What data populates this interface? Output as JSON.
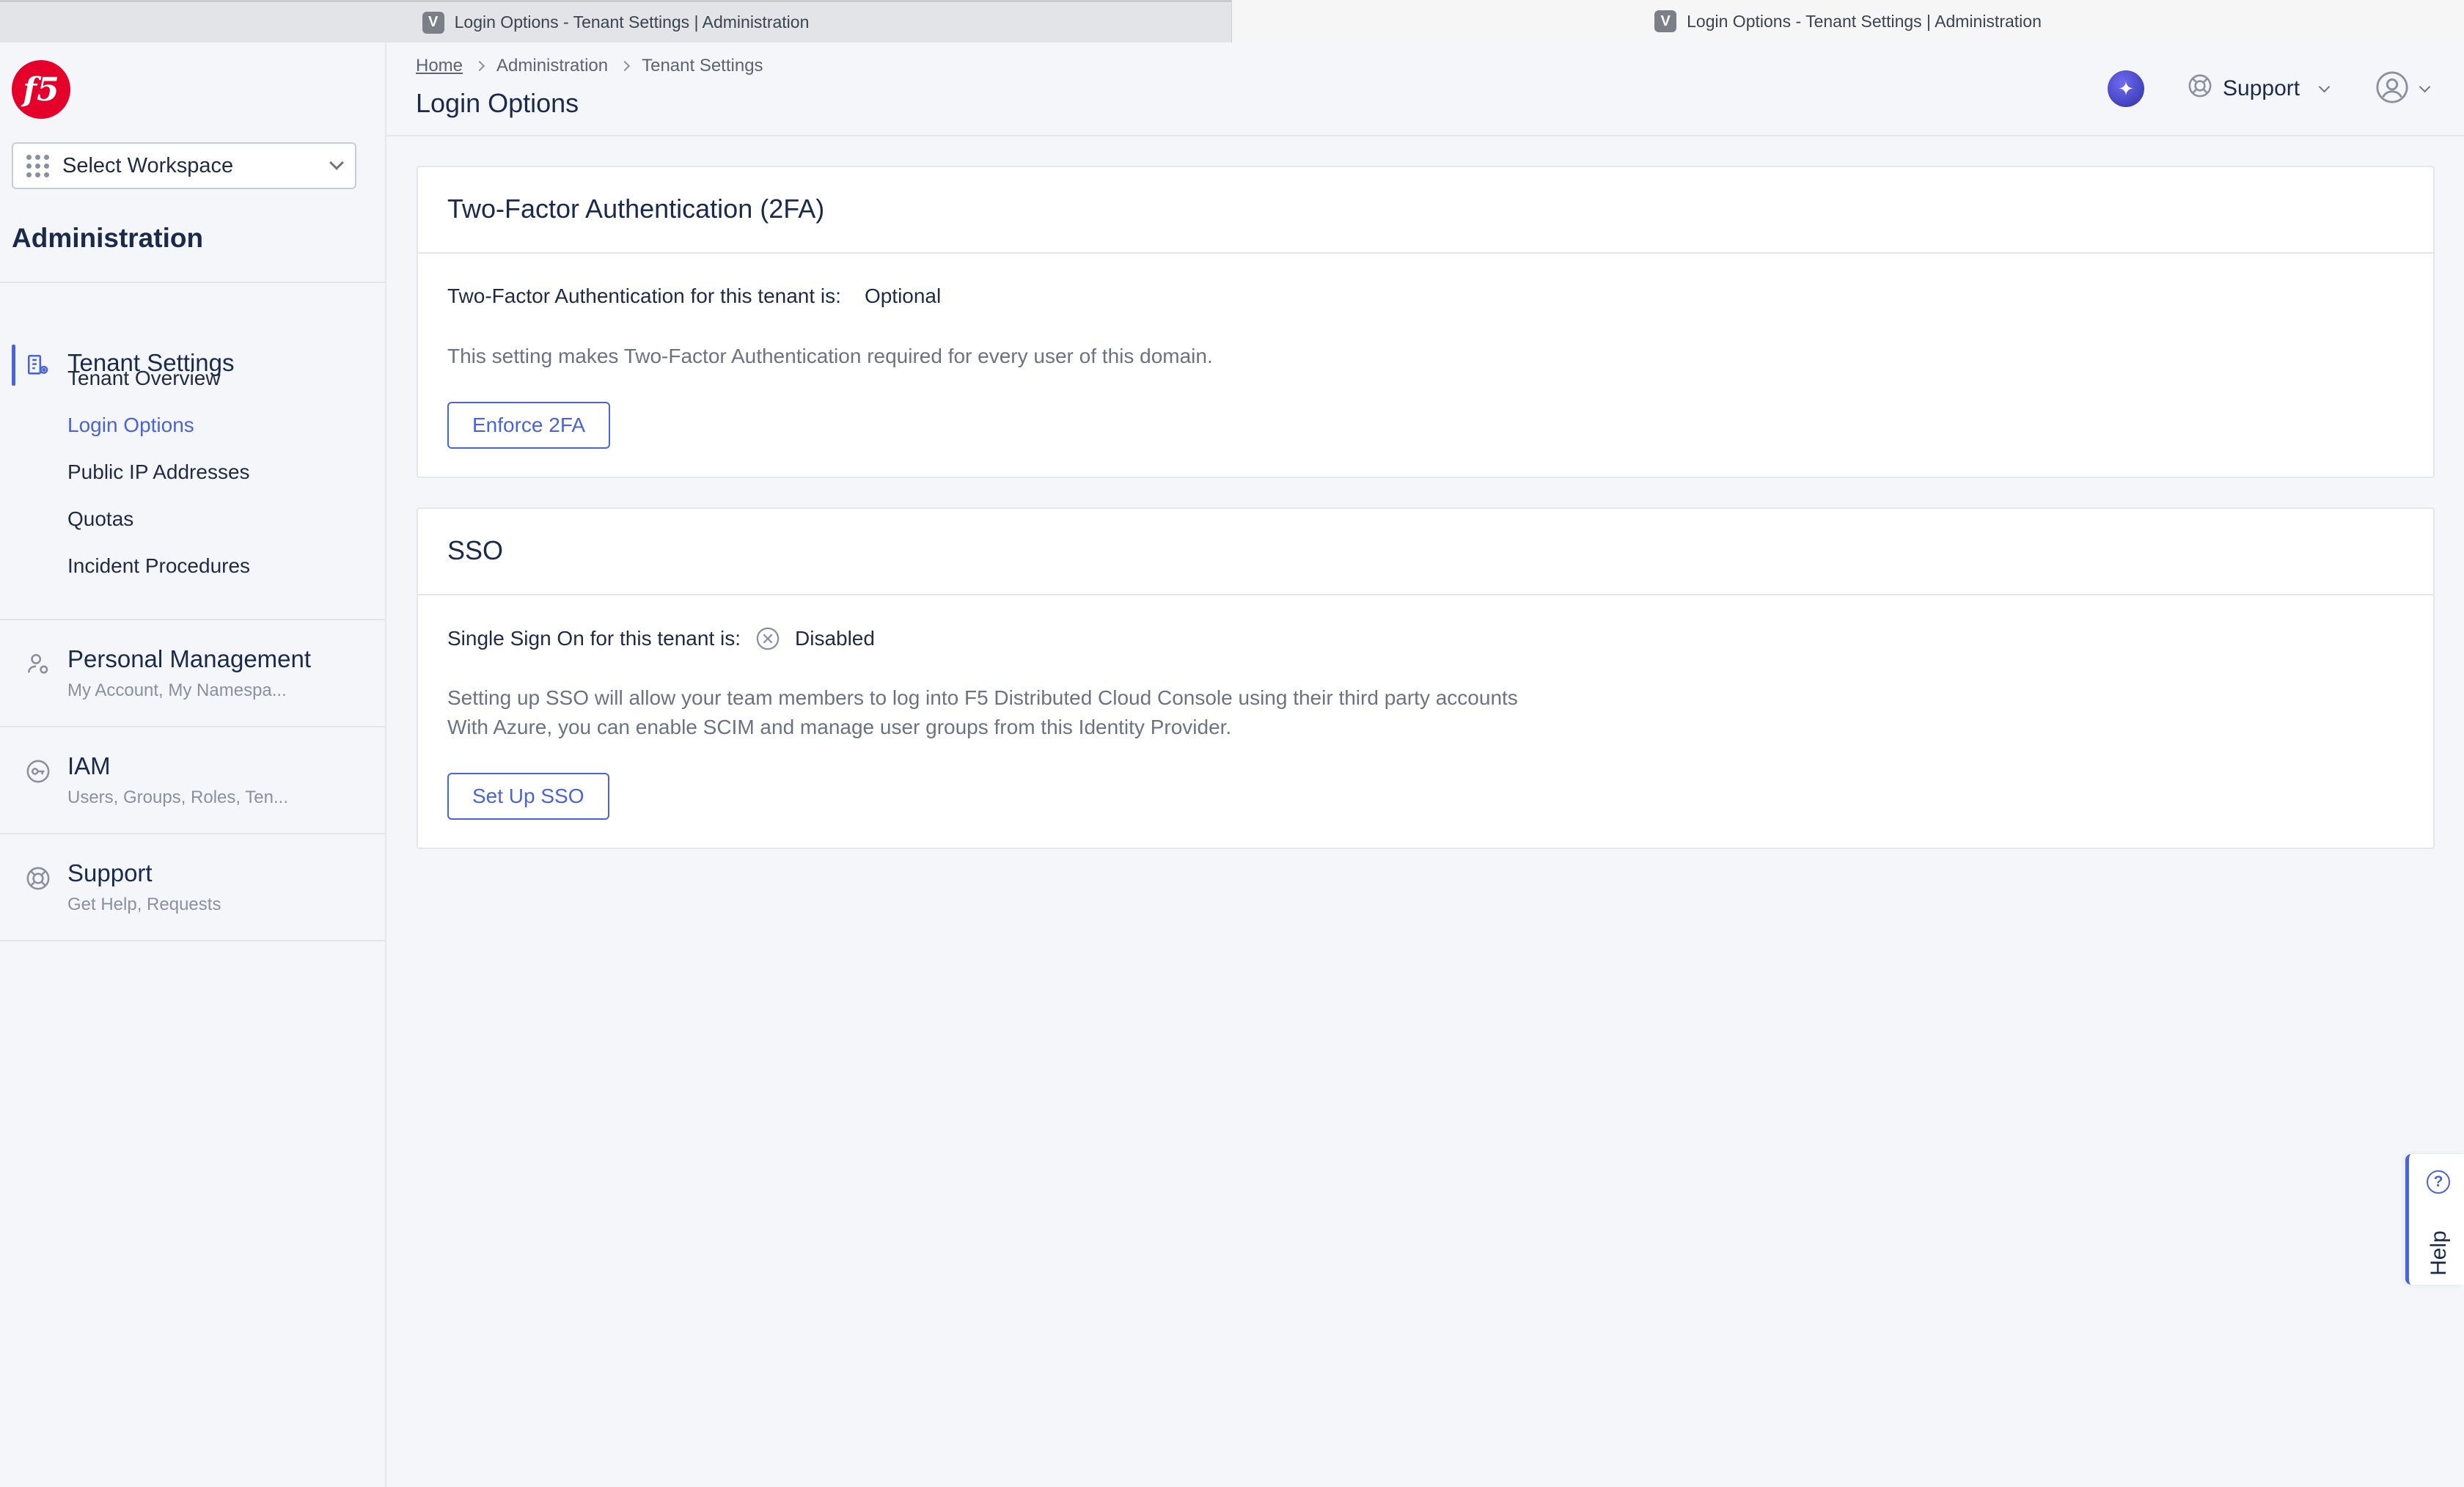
{
  "browser": {
    "tabs": [
      {
        "favicon": "V",
        "title": "Login Options - Tenant Settings | Administration"
      },
      {
        "favicon": "V",
        "title": "Login Options - Tenant Settings | Administration"
      }
    ]
  },
  "sidebar": {
    "logo_text": "f5",
    "workspace_label": "Select Workspace",
    "title": "Administration",
    "tenant_settings": {
      "label": "Tenant Settings",
      "icon": "building-gear-icon",
      "items": [
        "Tenant Overview",
        "Login Options",
        "Public IP Addresses",
        "Quotas",
        "Incident Procedures"
      ],
      "active_item": "Login Options"
    },
    "sections": [
      {
        "label": "Personal Management",
        "sub": "My Account, My Namespa...",
        "icon": "user-gear-icon"
      },
      {
        "label": "IAM",
        "sub": "Users, Groups, Roles, Ten...",
        "icon": "key-icon"
      },
      {
        "label": "Support",
        "sub": "Get Help, Requests",
        "icon": "lifebuoy-icon"
      }
    ]
  },
  "header": {
    "breadcrumbs": [
      "Home",
      "Administration",
      "Tenant Settings"
    ],
    "title": "Login Options",
    "support_label": "Support"
  },
  "twofa": {
    "title": "Two-Factor Authentication (2FA)",
    "status_label": "Two-Factor Authentication for this tenant is:",
    "status_value": "Optional",
    "description": "This setting makes Two-Factor Authentication required for every user of this domain.",
    "button_label": "Enforce 2FA"
  },
  "sso": {
    "title": "SSO",
    "status_label": "Single Sign On for this tenant is:",
    "status_value": "Disabled",
    "description_1": "Setting up SSO will allow your team members to log into F5 Distributed Cloud Console using their third party accounts",
    "description_2": "With Azure, you can enable SCIM and manage user groups from this Identity Provider.",
    "button_label": "Set Up SSO"
  },
  "help": {
    "label": "Help"
  },
  "colors": {
    "accent": "#4a64d8",
    "brand": "#e4002b"
  }
}
